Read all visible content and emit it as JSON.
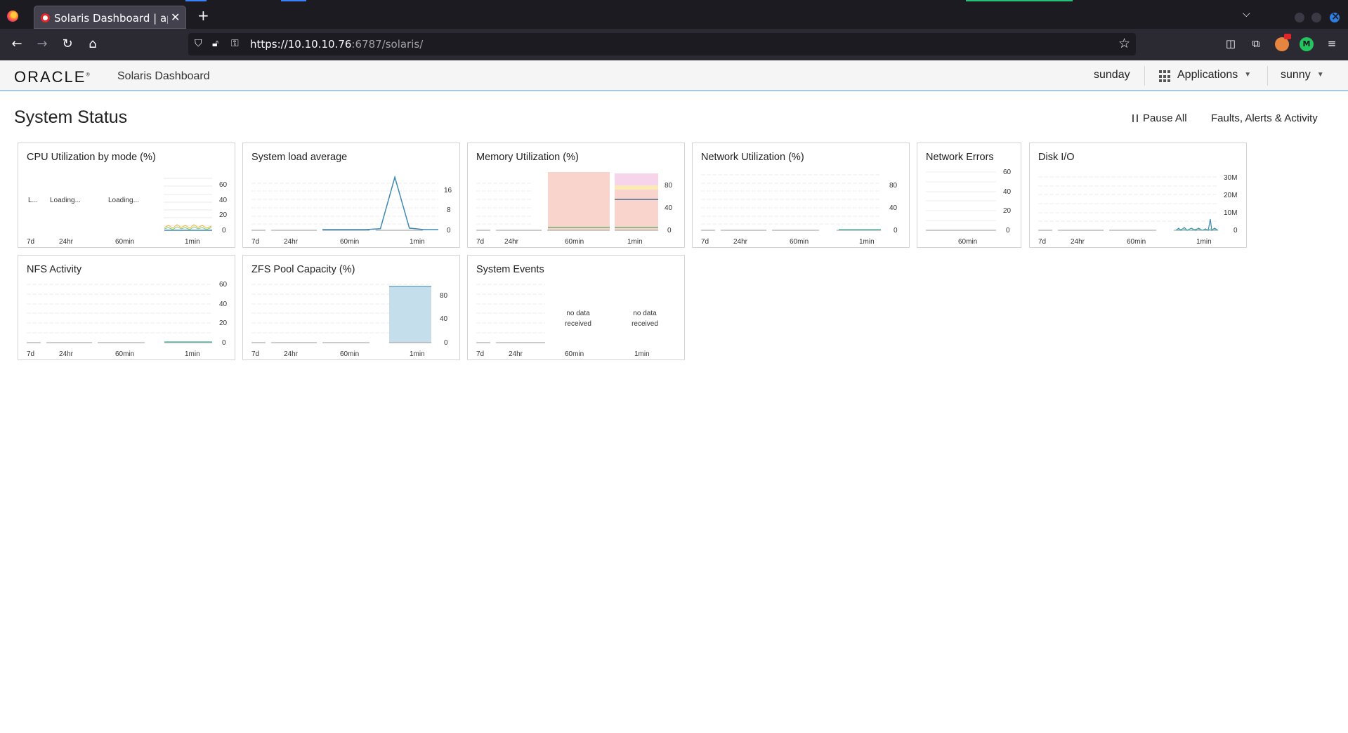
{
  "browser": {
    "tab_title": "Solaris Dashboard | apps",
    "url_host": "https://10.10.10.76",
    "url_path": ":6787/solaris/"
  },
  "header": {
    "logo": "ORACLE",
    "app_name": "Solaris Dashboard",
    "host": "sunday",
    "applications": "Applications",
    "user": "sunny"
  },
  "page": {
    "title": "System Status",
    "pause_all": "Pause All",
    "faults": "Faults, Alerts & Activity"
  },
  "labels": {
    "range_7d": "7d",
    "range_24hr": "24hr",
    "range_60min": "60min",
    "range_1min": "1min",
    "loading_short": "L...",
    "loading": "Loading...",
    "no_data": [
      "no data",
      "received"
    ]
  },
  "cards": [
    {
      "title": "CPU Utilization by mode (%)",
      "ticks": [
        "60",
        "40",
        "20",
        "0"
      ],
      "ranges": [
        "7d",
        "24hr",
        "60min",
        "1min"
      ]
    },
    {
      "title": "System load average",
      "ticks": [
        "16",
        "8",
        "0"
      ],
      "ranges": [
        "7d",
        "24hr",
        "60min",
        "1min"
      ]
    },
    {
      "title": "Memory Utilization (%)",
      "ticks": [
        "80",
        "40",
        "0"
      ],
      "ranges": [
        "7d",
        "24hr",
        "60min",
        "1min"
      ]
    },
    {
      "title": "Network Utilization (%)",
      "ticks": [
        "80",
        "40",
        "0"
      ],
      "ranges": [
        "7d",
        "24hr",
        "60min",
        "1min"
      ]
    },
    {
      "title": "Network Errors",
      "ticks": [
        "60",
        "40",
        "20",
        "0"
      ],
      "ranges": [
        "60min"
      ]
    },
    {
      "title": "Disk I/O",
      "ticks": [
        "30M",
        "20M",
        "10M",
        "0"
      ],
      "ranges": [
        "7d",
        "24hr",
        "60min",
        "1min"
      ]
    },
    {
      "title": "NFS Activity",
      "ticks": [
        "60",
        "40",
        "20",
        "0"
      ],
      "ranges": [
        "7d",
        "24hr",
        "60min",
        "1min"
      ]
    },
    {
      "title": "ZFS Pool Capacity (%)",
      "ticks": [
        "80",
        "40",
        "0"
      ],
      "ranges": [
        "7d",
        "24hr",
        "60min",
        "1min"
      ]
    },
    {
      "title": "System Events",
      "ticks": [],
      "ranges": [
        "7d",
        "24hr",
        "60min",
        "1min"
      ]
    }
  ],
  "chart_data": [
    {
      "type": "line",
      "title": "System load average",
      "series": [
        {
          "values": [
            0,
            0,
            0,
            0,
            0.3,
            18,
            0.5,
            0,
            0
          ]
        }
      ],
      "ylim": [
        0,
        20
      ]
    },
    {
      "type": "area",
      "title": "ZFS Pool Capacity (%)",
      "series": [
        {
          "values": [
            78
          ]
        }
      ],
      "ylim": [
        0,
        80
      ]
    }
  ]
}
